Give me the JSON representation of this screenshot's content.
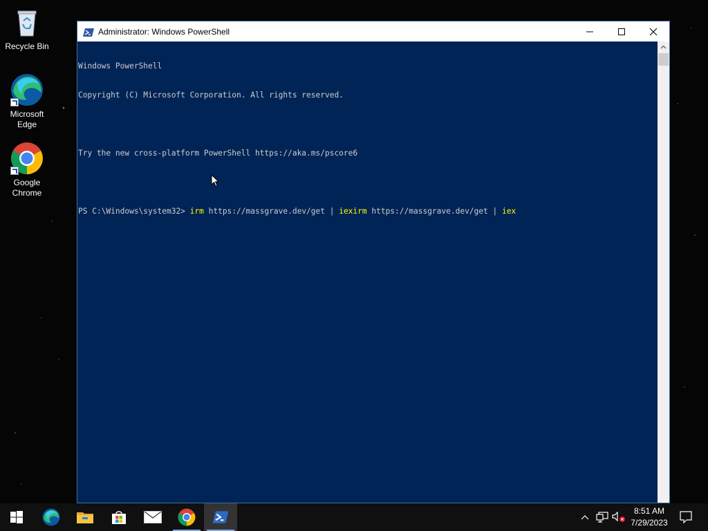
{
  "desktop": {
    "icons": [
      {
        "label": "Recycle Bin",
        "icon": "recycle-bin-icon"
      },
      {
        "label": "Microsoft Edge",
        "icon": "edge-icon"
      },
      {
        "label": "Google Chrome",
        "icon": "chrome-icon"
      }
    ]
  },
  "window": {
    "title": "Administrator: Windows PowerShell",
    "icon": "powershell-icon",
    "controls": {
      "minimize": "minimize-icon",
      "maximize": "maximize-icon",
      "close": "close-icon"
    },
    "colors": {
      "background": "#012456",
      "text": "#cccccc",
      "command": "#ffff00"
    }
  },
  "console": {
    "line1": "Windows PowerShell",
    "line2": "Copyright (C) Microsoft Corporation. All rights reserved.",
    "line3": "",
    "line4": "Try the new cross-platform PowerShell https://aka.ms/pscore6",
    "line5": "",
    "prompt": "PS C:\\Windows\\system32> ",
    "cmd": [
      {
        "text": "irm",
        "color": "yellow"
      },
      {
        "text": " https://massgrave.dev/get | ",
        "color": "white"
      },
      {
        "text": "iexirm",
        "color": "yellow"
      },
      {
        "text": " https://massgrave.dev/get | ",
        "color": "white"
      },
      {
        "text": "iex",
        "color": "yellow"
      }
    ]
  },
  "taskbar": {
    "items": [
      "start-icon",
      "edge-icon",
      "file-explorer-icon",
      "store-icon",
      "mail-icon",
      "chrome-icon",
      "powershell-icon"
    ],
    "tray": [
      "chevron-up-icon",
      "network-icon",
      "volume-muted-icon"
    ],
    "time": "8:51 AM",
    "date": "7/29/2023",
    "notification": "action-center-icon"
  }
}
